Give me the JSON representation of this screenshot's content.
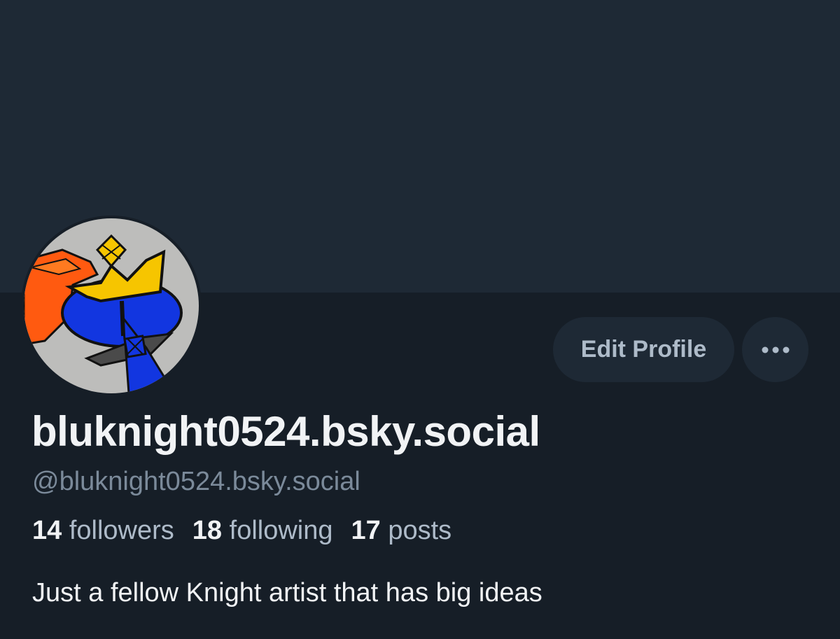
{
  "profile": {
    "display_name": "bluknight0524.bsky.social",
    "handle": "@bluknight0524.bsky.social",
    "bio": "Just a fellow Knight artist that has big ideas",
    "avatar_icon": "knight-crown-avatar"
  },
  "actions": {
    "edit_label": "Edit Profile",
    "more_icon": "ellipsis-icon"
  },
  "stats": [
    {
      "count": "14",
      "label": "followers"
    },
    {
      "count": "18",
      "label": "following"
    },
    {
      "count": "17",
      "label": "posts"
    }
  ],
  "colors": {
    "background": "#161e27",
    "banner": "#1e2935",
    "button_bg": "#1e2935",
    "button_text": "#aebbc9",
    "primary_text": "#f1f3f5",
    "secondary_text": "#7b8a9a"
  }
}
